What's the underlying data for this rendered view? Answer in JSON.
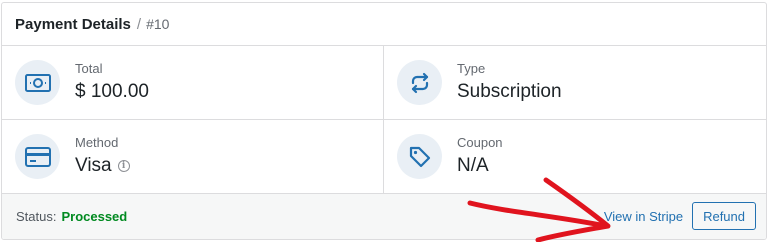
{
  "header": {
    "title": "Payment Details",
    "separator": "/",
    "id": "#10"
  },
  "total": {
    "label": "Total",
    "value": "$ 100.00",
    "icon": "cash-icon"
  },
  "type": {
    "label": "Type",
    "value": "Subscription",
    "icon": "repeat-icon"
  },
  "method": {
    "label": "Method",
    "value": "Visa",
    "icon": "credit-card-icon",
    "info_glyph": "i"
  },
  "coupon": {
    "label": "Coupon",
    "value": "N/A",
    "icon": "tag-icon"
  },
  "footer": {
    "status_label": "Status:",
    "status_value": "Processed",
    "view_link": "View in Stripe",
    "refund_button": "Refund"
  },
  "colors": {
    "accent": "#2271b1",
    "status_success": "#008a20",
    "annotation": "#e0141e",
    "icon_bg": "#e9eff5"
  }
}
